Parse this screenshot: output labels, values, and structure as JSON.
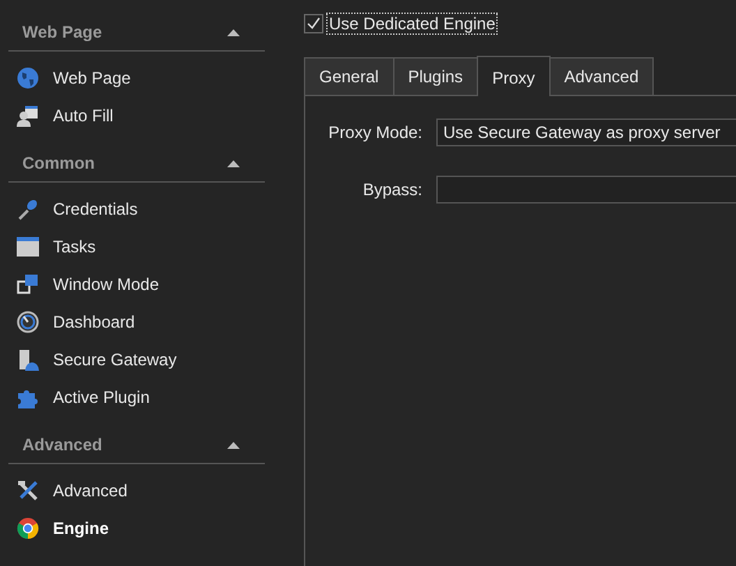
{
  "sidebar": {
    "sections": [
      {
        "title": "Web Page",
        "expanded": true,
        "items": [
          {
            "label": "Web Page",
            "kind": "globe",
            "selected": false
          },
          {
            "label": "Auto Fill",
            "kind": "person-card",
            "selected": false
          }
        ]
      },
      {
        "title": "Common",
        "expanded": true,
        "items": [
          {
            "label": "Credentials",
            "kind": "key",
            "selected": false
          },
          {
            "label": "Tasks",
            "kind": "window",
            "selected": false
          },
          {
            "label": "Window Mode",
            "kind": "windows",
            "selected": false
          },
          {
            "label": "Dashboard",
            "kind": "gauge",
            "selected": false
          },
          {
            "label": "Secure Gateway",
            "kind": "gateway",
            "selected": false
          },
          {
            "label": "Active Plugin",
            "kind": "puzzle",
            "selected": false
          }
        ]
      },
      {
        "title": "Advanced",
        "expanded": true,
        "items": [
          {
            "label": "Advanced",
            "kind": "tools",
            "selected": false
          },
          {
            "label": "Engine",
            "kind": "chrome",
            "selected": true
          }
        ]
      }
    ]
  },
  "dedicated_engine": {
    "label": "Use Dedicated Engine",
    "checked": true
  },
  "tabs": [
    {
      "label": "General",
      "selected": false
    },
    {
      "label": "Plugins",
      "selected": false
    },
    {
      "label": "Proxy",
      "selected": true
    },
    {
      "label": "Advanced",
      "selected": false
    }
  ],
  "proxy": {
    "mode_label": "Proxy Mode:",
    "mode_value": "Use Secure Gateway as proxy server",
    "bypass_label": "Bypass:"
  }
}
